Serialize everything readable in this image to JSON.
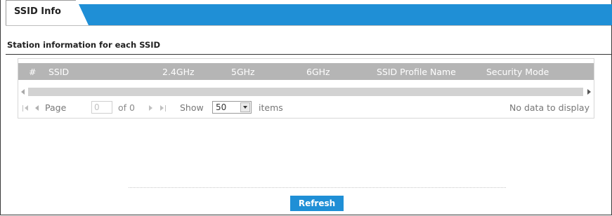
{
  "tabs": [
    {
      "label": "SSID Info",
      "active": true
    }
  ],
  "section": {
    "title": "Station information for each SSID"
  },
  "grid": {
    "columns": [
      "#",
      "SSID",
      "2.4GHz",
      "5GHz",
      "6GHz",
      "SSID Profile Name",
      "Security Mode"
    ],
    "rows": []
  },
  "pager": {
    "page_label": "Page",
    "page_value": "0",
    "of_label": "of 0",
    "show_label": "Show",
    "page_size": "50",
    "items_label": "items",
    "empty_message": "No data to display"
  },
  "actions": {
    "refresh_label": "Refresh"
  },
  "colors": {
    "accent": "#1f8fd6",
    "header_bg": "#b5b5b5",
    "scroll_track": "#d2d2d2"
  }
}
